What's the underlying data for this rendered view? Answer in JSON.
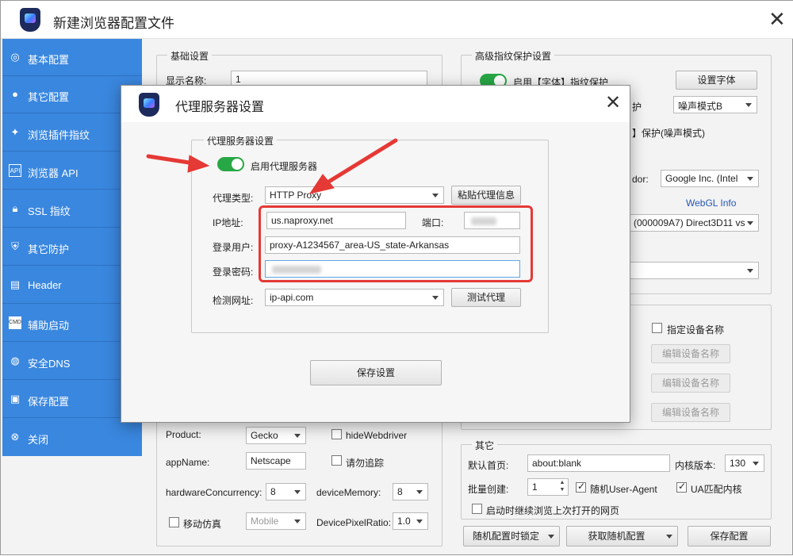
{
  "window": {
    "title": "新建浏览器配置文件",
    "close_icon": "close-icon"
  },
  "sidebar": {
    "items": [
      {
        "label": "基本配置",
        "icon": "compass-icon"
      },
      {
        "label": "其它配置",
        "icon": "chrome-icon"
      },
      {
        "label": "浏览插件指纹",
        "icon": "plugin-icon"
      },
      {
        "label": "浏览器 API",
        "icon": "api-icon"
      },
      {
        "label": "SSL 指纹",
        "icon": "lock-icon"
      },
      {
        "label": "其它防护",
        "icon": "shield-icon"
      },
      {
        "label": "Header",
        "icon": "header-icon"
      },
      {
        "label": "辅助启动",
        "icon": "cmd-icon"
      },
      {
        "label": "安全DNS",
        "icon": "globe-icon"
      },
      {
        "label": "保存配置",
        "icon": "save-icon"
      },
      {
        "label": "关闭",
        "icon": "close-circle-icon"
      }
    ]
  },
  "basic": {
    "title": "基础设置",
    "display_name_label": "显示名称:",
    "display_name_value": "1"
  },
  "advanced": {
    "title": "高级指纹保护设置",
    "font_toggle_label": "启用【字体】指纹保护",
    "font_button": "设置字体",
    "row2_label_tail": "护",
    "row2_select": "噪声模式B",
    "row3_label_tail": "】保护(噪声模式)",
    "vendor_label_tail": "dor:",
    "vendor_select": "Google Inc. (Intel",
    "webgl_info": "WebGL Info",
    "renderer_select": "(000009A7) Direct3D11 vs",
    "blank_select": ""
  },
  "device": {
    "specify_label": "指定设备名称",
    "edit_button": "编辑设备名称"
  },
  "navigator": {
    "product_label": "Product:",
    "product_value": "Gecko",
    "hide_webdriver_label": "hideWebdriver",
    "appname_label": "appName:",
    "appname_value": "Netscape",
    "dnt_label": "请勿追踪",
    "hw_label": "hardwareConcurrency:",
    "hw_value": "8",
    "mem_label": "deviceMemory:",
    "mem_value": "8",
    "mobile_label": "移动仿真",
    "mobile_value": "Mobile",
    "dpr_label": "DevicePixelRatio:",
    "dpr_value": "1.0"
  },
  "other": {
    "title": "其它",
    "homepage_label": "默认首页:",
    "homepage_value": "about:blank",
    "kernel_label": "内核版本:",
    "kernel_value": "130",
    "batch_label": "批量创建:",
    "batch_value": "1",
    "random_ua_label": "随机User-Agent",
    "ua_match_label": "UA匹配内核",
    "continue_label": "启动时继续浏览上次打开的网页"
  },
  "bottom": {
    "lock_random": "随机配置时锁定",
    "get_random": "获取随机配置",
    "save_config": "保存配置"
  },
  "dialog": {
    "title": "代理服务器设置",
    "group_title": "代理服务器设置",
    "enable_label": "启用代理服务器",
    "type_label": "代理类型:",
    "type_value": "HTTP Proxy",
    "paste_button": "粘贴代理信息",
    "ip_label": "IP地址:",
    "ip_value": "us.naproxy.net",
    "port_label": "端口:",
    "user_label": "登录用户:",
    "user_value": "proxy-A1234567_area-US_state-Arkansas",
    "pass_label": "登录密码:",
    "check_label": "检测网址:",
    "check_value": "ip-api.com",
    "test_button": "测试代理",
    "save_button": "保存设置"
  },
  "colors": {
    "sidebar": "#3a87df",
    "toggle_on": "#27a745",
    "annotation_red": "#e53935",
    "link": "#2456b8"
  }
}
